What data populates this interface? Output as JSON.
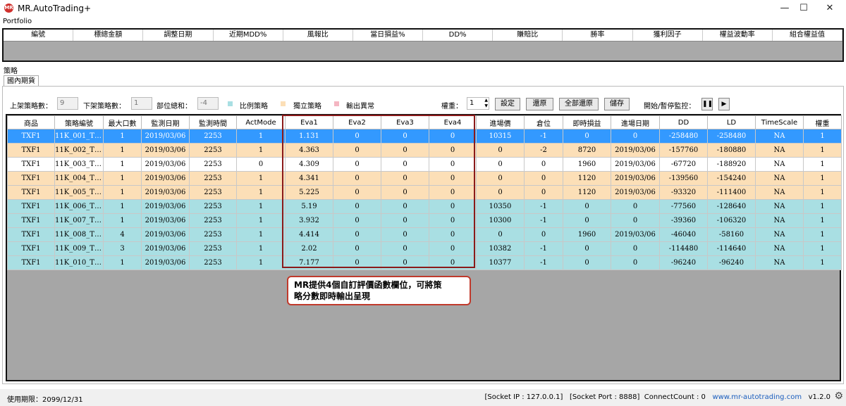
{
  "window": {
    "title": "MR.AutoTrading+",
    "icon_text": "MR",
    "minimize": "—",
    "maximize": "☐",
    "close": "✕"
  },
  "portfolio": {
    "label": "Portfolio",
    "headers": [
      "編號",
      "標總金額",
      "調整日期",
      "近期MDD%",
      "風報比",
      "當日損益%",
      "DD%",
      "賺賠比",
      "勝率",
      "獲利因子",
      "權益波動率",
      "組合權益值"
    ]
  },
  "strategy": {
    "section_label": "策略",
    "tab": "國內期貨",
    "controls": {
      "listed_label": "上架策略數：",
      "listed_value": "9",
      "delisted_label": "下架策略數：",
      "delisted_value": "1",
      "position_label": "部位總和：",
      "position_value": "-4",
      "legend_proportional": "比例策略",
      "legend_independent": "獨立策略",
      "legend_error": "輸出異常",
      "weight_label": "權重：",
      "weight_value": "1",
      "set_btn": "設定",
      "restore_btn": "還原",
      "restore_all_btn": "全部還原",
      "save_btn": "儲存",
      "monitor_label": "開始/暫停監控："
    },
    "colors": {
      "proportional": "#a9dfe3",
      "independent": "#fcdfb7",
      "error": "#f4b6c2",
      "selected": "#3399ff"
    },
    "columns": [
      "商品",
      "策略編號",
      "最大口數",
      "監測日期",
      "監測時間",
      "ActMode",
      "Eva1",
      "Eva2",
      "Eva3",
      "Eva4",
      "進場價",
      "倉位",
      "即時損益",
      "進場日期",
      "DD",
      "LD",
      "TimeScale",
      "權重"
    ],
    "rows": [
      {
        "type": "sel",
        "cells": [
          "TXF1",
          "11K_001_T2...",
          "1",
          "2019/03/06",
          "2253",
          "1",
          "1.131",
          "0",
          "0",
          "0",
          "10315",
          "-1",
          "0",
          "0",
          "-258480",
          "-258480",
          "NA",
          "1"
        ]
      },
      {
        "type": "independent",
        "cells": [
          "TXF1",
          "11K_002_T2...",
          "1",
          "2019/03/06",
          "2253",
          "1",
          "4.363",
          "0",
          "0",
          "0",
          "0",
          "-2",
          "8720",
          "2019/03/06",
          "-157760",
          "-180880",
          "NA",
          "1"
        ]
      },
      {
        "type": "plain",
        "cells": [
          "TXF1",
          "11K_003_T2...",
          "1",
          "2019/03/06",
          "2253",
          "0",
          "4.309",
          "0",
          "0",
          "0",
          "0",
          "0",
          "1960",
          "2019/03/06",
          "-67720",
          "-188920",
          "NA",
          "1"
        ]
      },
      {
        "type": "independent",
        "cells": [
          "TXF1",
          "11K_004_T2...",
          "1",
          "2019/03/06",
          "2253",
          "1",
          "4.341",
          "0",
          "0",
          "0",
          "0",
          "0",
          "1120",
          "2019/03/06",
          "-139560",
          "-154240",
          "NA",
          "1"
        ]
      },
      {
        "type": "independent",
        "cells": [
          "TXF1",
          "11K_005_T2...",
          "1",
          "2019/03/06",
          "2253",
          "1",
          "5.225",
          "0",
          "0",
          "0",
          "0",
          "0",
          "1120",
          "2019/03/06",
          "-93320",
          "-111400",
          "NA",
          "1"
        ]
      },
      {
        "type": "proportional",
        "cells": [
          "TXF1",
          "11K_006_T2...",
          "1",
          "2019/03/06",
          "2253",
          "1",
          "5.19",
          "0",
          "0",
          "0",
          "10350",
          "-1",
          "0",
          "0",
          "-77560",
          "-128640",
          "NA",
          "1"
        ]
      },
      {
        "type": "proportional",
        "cells": [
          "TXF1",
          "11K_007_T2...",
          "1",
          "2019/03/06",
          "2253",
          "1",
          "3.932",
          "0",
          "0",
          "0",
          "10300",
          "-1",
          "0",
          "0",
          "-39360",
          "-106320",
          "NA",
          "1"
        ]
      },
      {
        "type": "proportional",
        "cells": [
          "TXF1",
          "11K_008_T2...",
          "4",
          "2019/03/06",
          "2253",
          "1",
          "4.414",
          "0",
          "0",
          "0",
          "0",
          "0",
          "1960",
          "2019/03/06",
          "-46040",
          "-58160",
          "NA",
          "1"
        ]
      },
      {
        "type": "proportional",
        "cells": [
          "TXF1",
          "11K_009_T2...",
          "3",
          "2019/03/06",
          "2253",
          "1",
          "2.02",
          "0",
          "0",
          "0",
          "10382",
          "-1",
          "0",
          "0",
          "-114480",
          "-114640",
          "NA",
          "1"
        ]
      },
      {
        "type": "proportional",
        "cells": [
          "TXF1",
          "11K_010_T2...",
          "1",
          "2019/03/06",
          "2253",
          "1",
          "7.177",
          "0",
          "0",
          "0",
          "10377",
          "-1",
          "0",
          "0",
          "-96240",
          "-96240",
          "NA",
          "1"
        ]
      }
    ]
  },
  "callout": {
    "line1": "MR提供4個自訂評價函數欄位，可將策",
    "line2": "略分數即時輸出呈現"
  },
  "status": {
    "expiry": "使用期限：2099/12/31",
    "socket_ip": "[Socket IP : 127.0.0.1]",
    "socket_port": "[Socket Port : 8888]",
    "connect_count": "ConnectCount : 0",
    "website": "www.mr-autotrading.com",
    "version": "v1.2.0"
  }
}
